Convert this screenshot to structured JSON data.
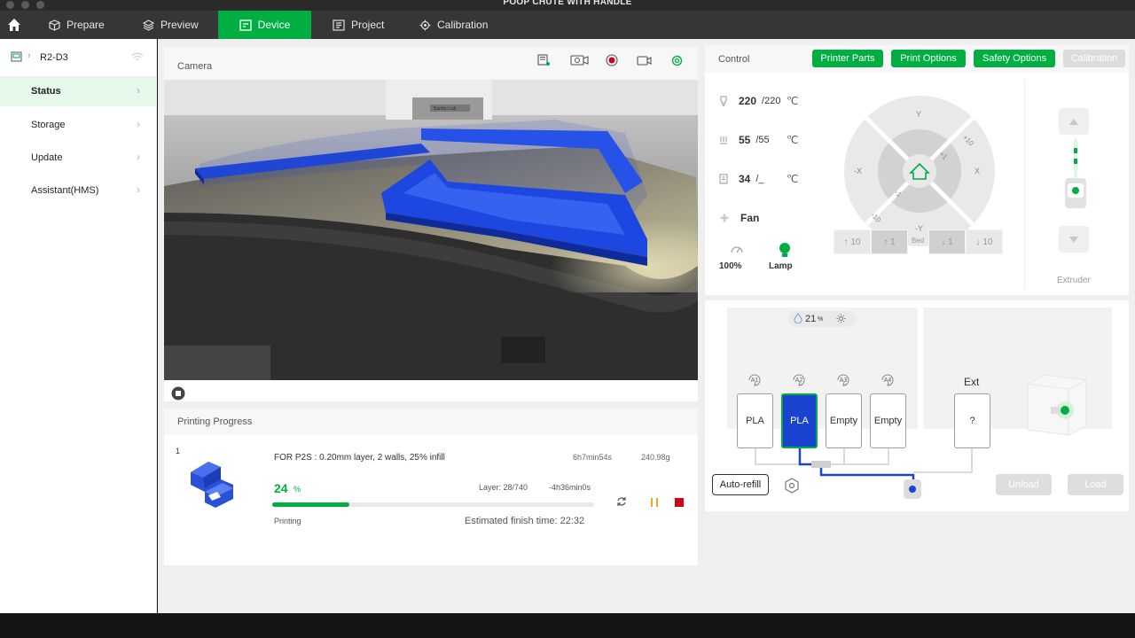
{
  "window": {
    "title": "POOP CHUTE WITH HANDLE"
  },
  "nav": {
    "tabs": [
      {
        "label": "Prepare",
        "icon": "cube-icon"
      },
      {
        "label": "Preview",
        "icon": "layers-icon"
      },
      {
        "label": "Device",
        "icon": "device-icon",
        "active": true
      },
      {
        "label": "Project",
        "icon": "project-icon"
      },
      {
        "label": "Calibration",
        "icon": "calibration-icon"
      }
    ]
  },
  "sidebar": {
    "device_name": "R2-D3",
    "items": [
      {
        "label": "Status",
        "active": true
      },
      {
        "label": "Storage"
      },
      {
        "label": "Update"
      },
      {
        "label": "Assistant(HMS)"
      }
    ]
  },
  "camera": {
    "title": "Camera"
  },
  "progress": {
    "title": "Printing Progress",
    "plate_number": "1",
    "job_name": "FOR P2S : 0.20mm layer, 2 walls, 25% infill",
    "print_time": "6h7min54s",
    "weight": "240.98g",
    "percent": "24",
    "percent_unit": "%",
    "progress_fraction": 0.24,
    "layer": "Layer: 28/740",
    "remaining": "-4h36min0s",
    "status": "Printing",
    "finish_time": "Estimated finish time: 22:32"
  },
  "control": {
    "title": "Control",
    "buttons": {
      "printer_parts": "Printer Parts",
      "print_options": "Print Options",
      "safety_options": "Safety Options",
      "calibration": "Calibration"
    },
    "nozzle": {
      "current": "220",
      "target": "/220",
      "unit": "℃"
    },
    "bed": {
      "current": "55",
      "target": "/55",
      "unit": "℃"
    },
    "chamber": {
      "current": "34",
      "target": "/_",
      "unit": "℃"
    },
    "fan_label": "Fan",
    "speed_value": "100%",
    "lamp_label": "Lamp",
    "jog": {
      "y_plus": "Y",
      "y_minus": "-Y",
      "x_plus": "X",
      "x_minus": "-X",
      "plus10": "+10",
      "plus1": "+1",
      "minus1": "-1",
      "minus10": "-10"
    },
    "bed_buttons": {
      "up10": "10",
      "up1": "1",
      "label": "Bed",
      "down1": "1",
      "down10": "10"
    },
    "extruder_label": "Extruder"
  },
  "ams": {
    "humidity": "21",
    "humidity_unit": "%",
    "slots": [
      {
        "id": "A1",
        "label": "PLA",
        "selected": false
      },
      {
        "id": "A2",
        "label": "PLA",
        "selected": true,
        "color": "#1a44cf"
      },
      {
        "id": "A3",
        "label": "Empty",
        "selected": false
      },
      {
        "id": "A4",
        "label": "Empty",
        "selected": false
      }
    ],
    "ext_title": "Ext",
    "ext_slot": "?",
    "auto_refill": "Auto-refill",
    "unload": "Unload",
    "load": "Load"
  },
  "colors": {
    "accent": "#00ae42",
    "filament": "#1a44cf",
    "stop": "#d0021b",
    "pause": "#f5a623"
  }
}
